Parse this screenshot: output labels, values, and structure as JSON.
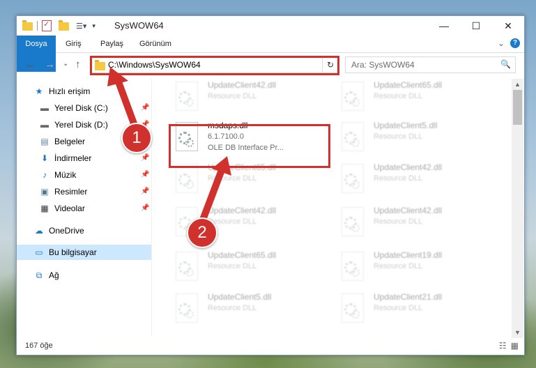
{
  "window": {
    "title": "SysWOW64",
    "controls": {
      "minimize": "—",
      "maximize": "☐",
      "close": "✕"
    }
  },
  "ribbon": {
    "tabs": [
      "Dosya",
      "Giriş",
      "Paylaş",
      "Görünüm"
    ],
    "expand": "⌄",
    "help": "?"
  },
  "nav": {
    "back": "←",
    "forward": "→",
    "recent": "⌄",
    "up": "↑",
    "address": "C:\\Windows\\SysWOW64",
    "refresh": "↻",
    "search_placeholder": "Ara: SysWOW64",
    "search_icon": "🔍"
  },
  "sidebar": {
    "items": [
      {
        "label": "Hızlı erişim",
        "icon": "star-icon",
        "glyph": "★",
        "pinned": false
      },
      {
        "label": "Yerel Disk (C:)",
        "icon": "drive-icon",
        "glyph": "▬",
        "pinned": true
      },
      {
        "label": "Yerel Disk (D:)",
        "icon": "drive-icon",
        "glyph": "▬",
        "pinned": true
      },
      {
        "label": "Belgeler",
        "icon": "documents-icon",
        "glyph": "▤",
        "pinned": true
      },
      {
        "label": "İndirmeler",
        "icon": "downloads-icon",
        "glyph": "⬇",
        "pinned": true
      },
      {
        "label": "Müzik",
        "icon": "music-icon",
        "glyph": "♪",
        "pinned": true
      },
      {
        "label": "Resimler",
        "icon": "pictures-icon",
        "glyph": "▣",
        "pinned": true
      },
      {
        "label": "Videolar",
        "icon": "videos-icon",
        "glyph": "▦",
        "pinned": true
      },
      {
        "label": "OneDrive",
        "icon": "onedrive-icon",
        "glyph": "☁",
        "pinned": false
      },
      {
        "label": "Bu bilgisayar",
        "icon": "computer-icon",
        "glyph": "▭",
        "pinned": false
      },
      {
        "label": "Ağ",
        "icon": "network-icon",
        "glyph": "⧉",
        "pinned": false
      }
    ],
    "selected": "Bu bilgisayar",
    "pin_glyph": "📌"
  },
  "files": [
    {
      "name": "UpdateClient42.dll",
      "type": "Resource DLL",
      "faded": true
    },
    {
      "name": "UpdateClient65.dll",
      "type": "Resource DLL",
      "faded": true
    },
    {
      "name": "msdaps.dll",
      "version": "6.1.7100.0",
      "type": "OLE DB Interface Pr...",
      "faded": false
    },
    {
      "name": "UpdateClient5.dll",
      "type": "Resource DLL",
      "faded": true
    },
    {
      "name": "UpdateClient65.dll",
      "type": "Resource DLL",
      "faded": true
    },
    {
      "name": "UpdateClient42.dll",
      "type": "Resource DLL",
      "faded": true
    },
    {
      "name": "UpdateClient42.dll",
      "type": "Resource DLL",
      "faded": true
    },
    {
      "name": "UpdateClient42.dll",
      "type": "Resource DLL",
      "faded": true
    },
    {
      "name": "UpdateClient65.dll",
      "type": "Resource DLL",
      "faded": true
    },
    {
      "name": "UpdateClient19.dll",
      "type": "Resource DLL",
      "faded": true
    },
    {
      "name": "UpdateClient5.dll",
      "type": "Resource DLL",
      "faded": true
    },
    {
      "name": "UpdateClient21.dll",
      "type": "Resource DLL",
      "faded": true
    }
  ],
  "status": {
    "item_count": "167 öğe",
    "view_details": "☷",
    "view_tiles": "▦"
  },
  "annotations": {
    "step1": "1",
    "step2": "2",
    "color": "#d0312d"
  }
}
